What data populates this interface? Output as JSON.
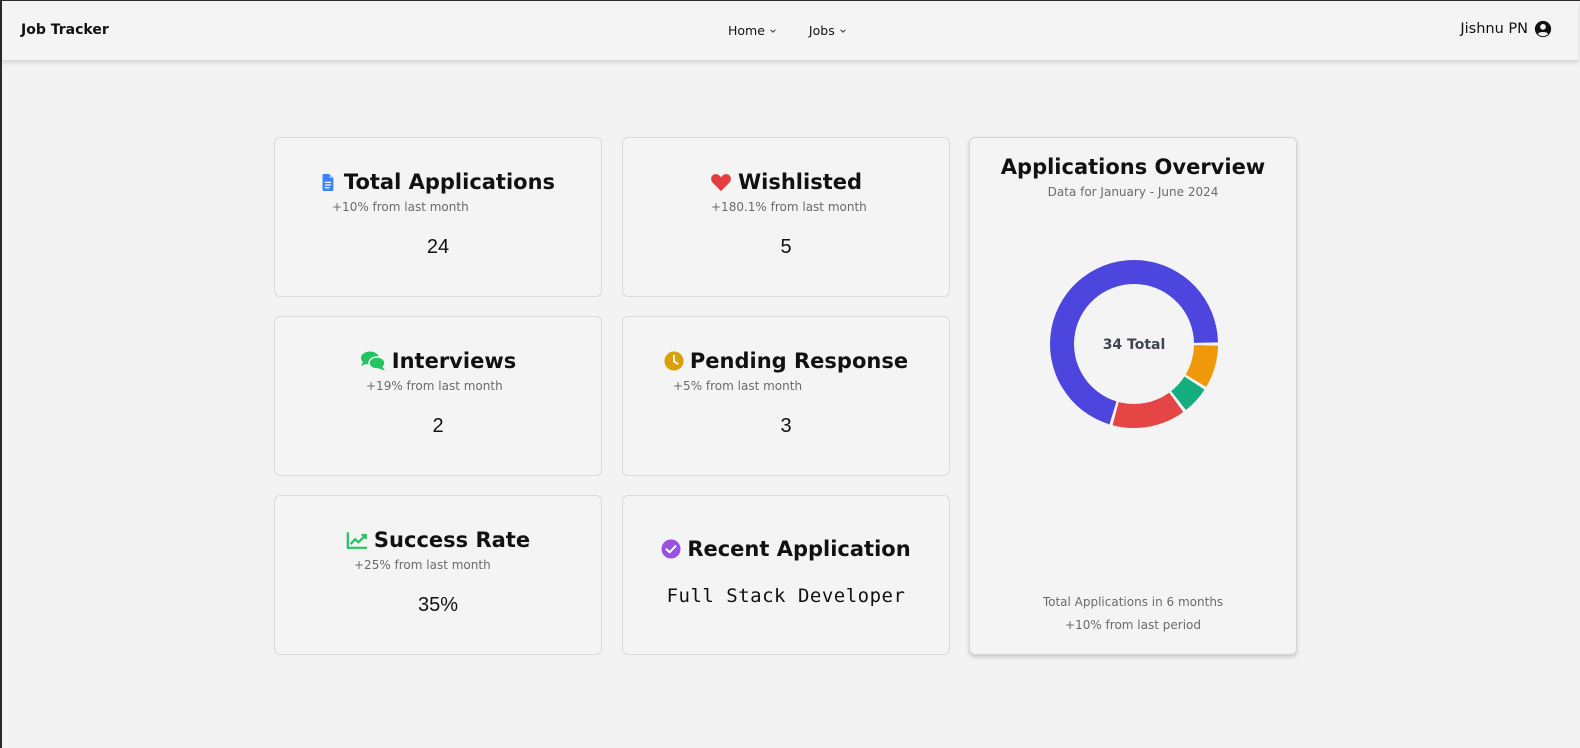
{
  "navbar": {
    "brand": "Job Tracker",
    "menu": [
      {
        "label": "Home"
      },
      {
        "label": "Jobs"
      }
    ],
    "user_name": "Jishnu PN"
  },
  "cards": {
    "total_applications": {
      "title": "Total Applications",
      "subtitle": "+10% from last month",
      "value": "24",
      "icon": "document-icon",
      "icon_color": "#3b82f6"
    },
    "wishlisted": {
      "title": "Wishlisted",
      "subtitle": "+180.1% from last month",
      "value": "5",
      "icon": "heart-icon",
      "icon_color": "#e53e3e"
    },
    "interviews": {
      "title": "Interviews",
      "subtitle": "+19% from last month",
      "value": "2",
      "icon": "chat-bubbles-icon",
      "icon_color": "#22c55e"
    },
    "pending_response": {
      "title": "Pending Response",
      "subtitle": "+5% from last month",
      "value": "3",
      "icon": "clock-icon",
      "icon_color": "#d9a00b"
    },
    "success_rate": {
      "title": "Success Rate",
      "subtitle": "+25% from last month",
      "value": "35%",
      "icon": "line-chart-icon",
      "icon_color": "#22c55e"
    },
    "recent_application": {
      "title": "Recent Application",
      "value": "Full Stack Developer",
      "icon": "check-circle-icon",
      "icon_color": "#9b51e0"
    }
  },
  "overview": {
    "title": "Applications Overview",
    "subtitle": "Data for January - June 2024",
    "center_label": "34 Total",
    "footer_line1": "Total Applications in 6 months",
    "footer_line2": "+10% from last period"
  },
  "chart_data": {
    "type": "pie",
    "total": 34,
    "series": [
      {
        "value": 24,
        "color": "#4c45de"
      },
      {
        "value": 3,
        "color": "#ef990a"
      },
      {
        "value": 2,
        "color": "#14ae7e"
      },
      {
        "value": 5,
        "color": "#e54545"
      }
    ]
  }
}
